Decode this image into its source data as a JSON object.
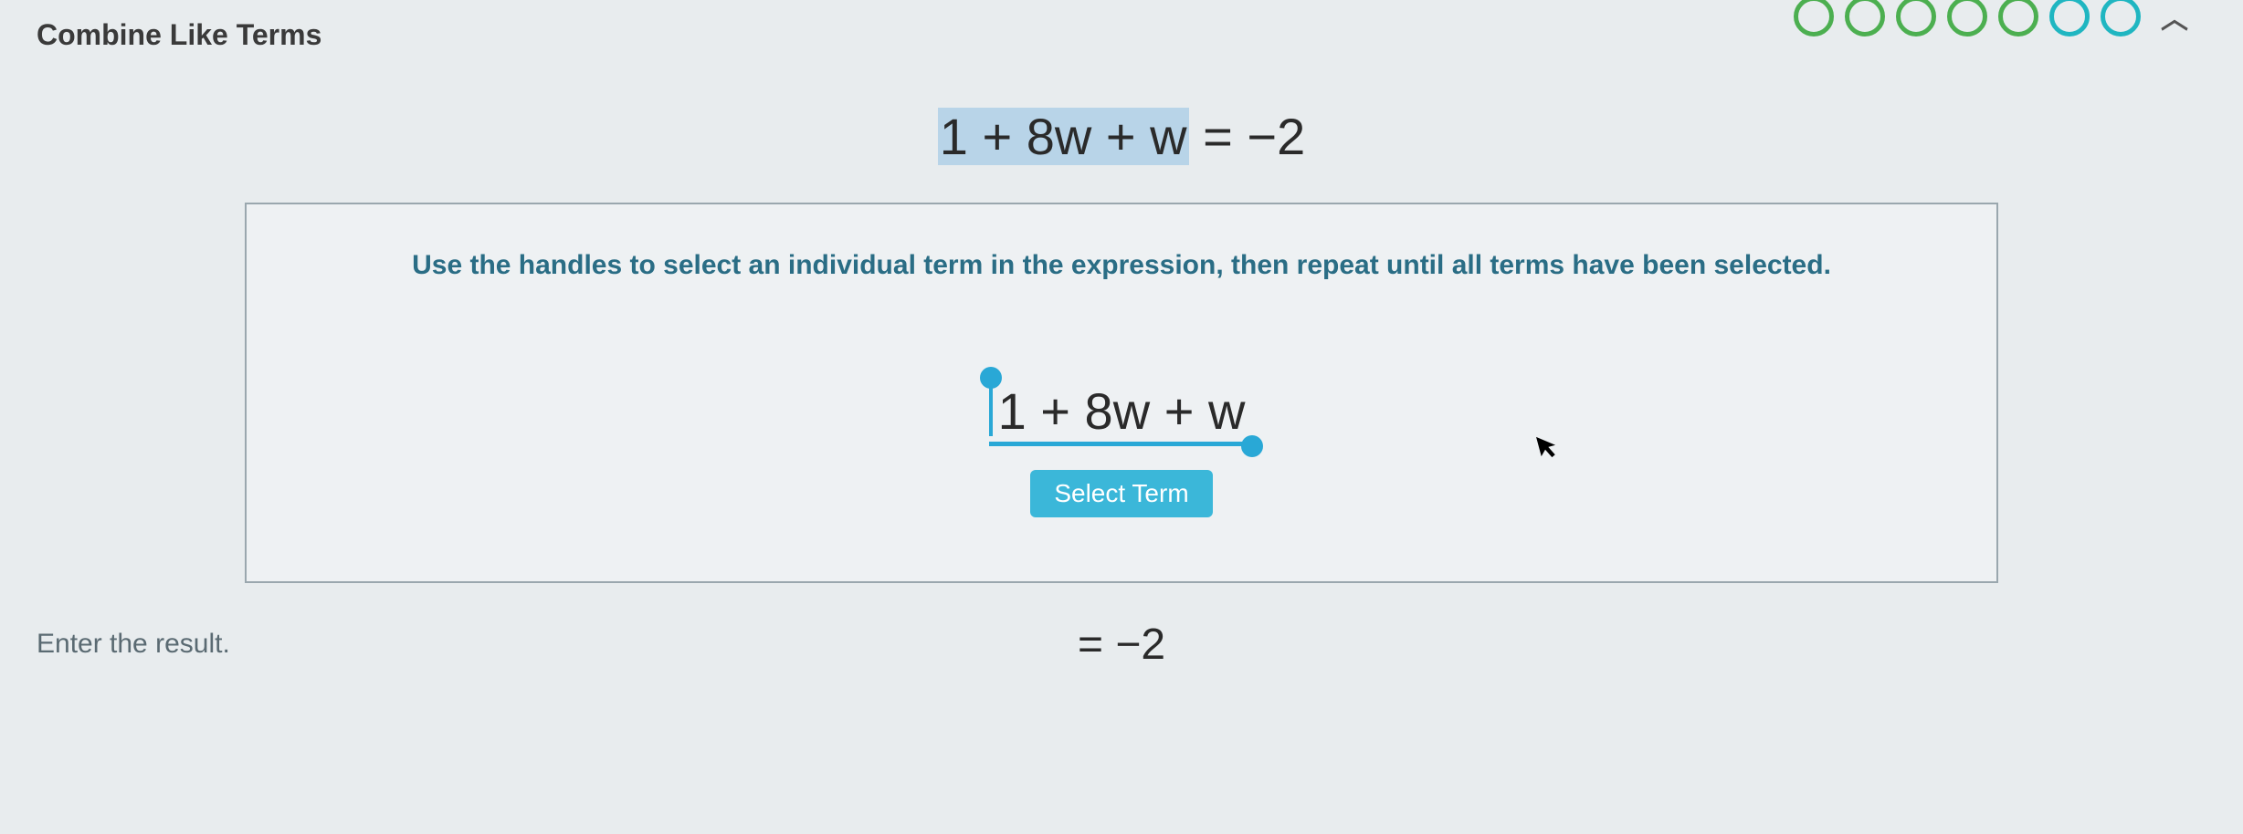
{
  "header": {
    "title": "Combine Like Terms"
  },
  "equation": {
    "left_highlighted": "1 + 8w + w",
    "equals_right": " = −2"
  },
  "panel": {
    "instruction": "Use the handles to select an individual term in the expression, then repeat until all terms have been selected.",
    "expression": "1 + 8w + w",
    "select_button": "Select Term"
  },
  "footer": {
    "prompt": "Enter the result.",
    "result_rhs": "= −2"
  },
  "progress": {
    "circles": [
      "green",
      "green",
      "green",
      "green",
      "green",
      "teal",
      "teal"
    ]
  }
}
